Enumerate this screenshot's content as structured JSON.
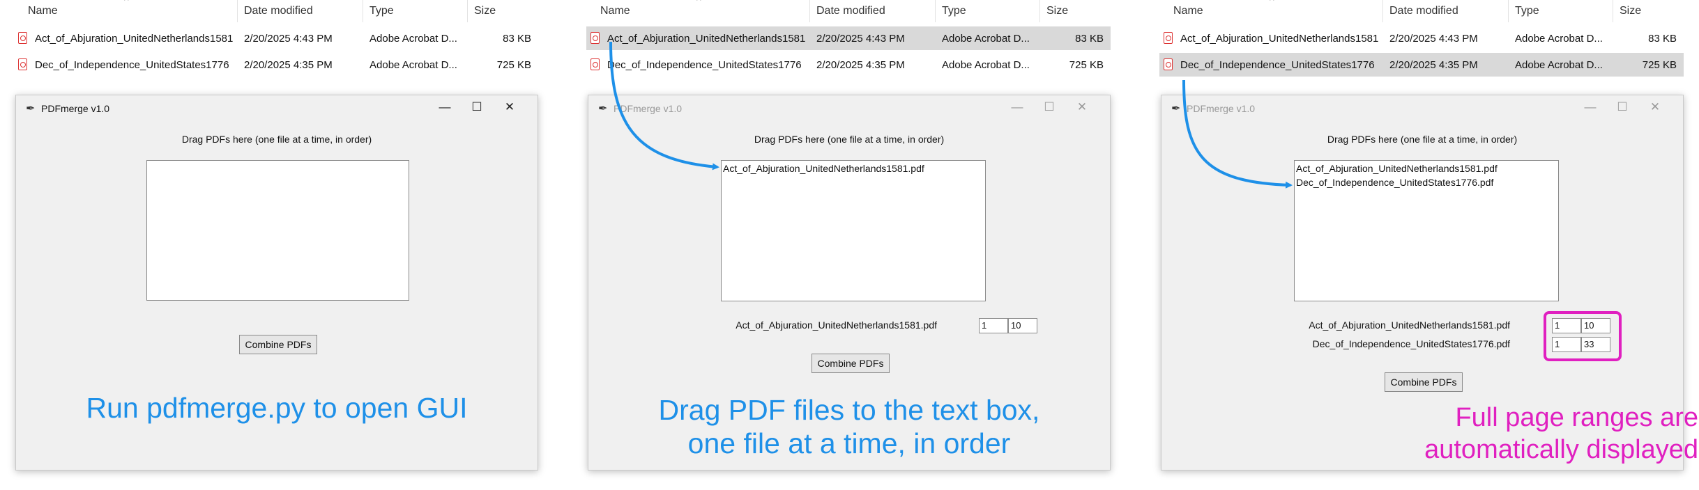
{
  "colors": {
    "blue": "#1e90e8",
    "magenta": "#e020c0"
  },
  "explorer": {
    "headers": {
      "name": "Name",
      "date": "Date modified",
      "type": "Type",
      "size": "Size"
    },
    "files": [
      {
        "name": "Act_of_Abjuration_UnitedNetherlands1581",
        "date": "2/20/2025 4:43 PM",
        "type": "Adobe Acrobat D...",
        "size": "83 KB"
      },
      {
        "name": "Dec_of_Independence_UnitedStates1776",
        "date": "2/20/2025 4:35 PM",
        "type": "Adobe Acrobat D...",
        "size": "725 KB"
      }
    ]
  },
  "window": {
    "title": "PDFmerge v1.0",
    "instruction": "Drag PDFs here   (one file at a time, in order)",
    "combine_label": "Combine PDFs",
    "icon": "feather-icon",
    "controls": {
      "minimize": "—",
      "maximize": "☐",
      "close": "✕"
    }
  },
  "panels": [
    {
      "listbox_items": [],
      "ranges": [],
      "caption": "Run pdfmerge.py to open GUI"
    },
    {
      "listbox_items": [
        "Act_of_Abjuration_UnitedNetherlands1581.pdf"
      ],
      "ranges": [
        {
          "file": "Act_of_Abjuration_UnitedNetherlands1581.pdf",
          "start": "1",
          "end": "10"
        }
      ],
      "caption_line1": "Drag PDF files to the text box,",
      "caption_line2": "one file at a time, in order"
    },
    {
      "listbox_items": [
        "Act_of_Abjuration_UnitedNetherlands1581.pdf",
        "Dec_of_Independence_UnitedStates1776.pdf"
      ],
      "ranges": [
        {
          "file": "Act_of_Abjuration_UnitedNetherlands1581.pdf",
          "start": "1",
          "end": "10"
        },
        {
          "file": "Dec_of_Independence_UnitedStates1776.pdf",
          "start": "1",
          "end": "33"
        }
      ],
      "caption_line1": "Full page ranges are",
      "caption_line2": "automatically displayed"
    }
  ]
}
